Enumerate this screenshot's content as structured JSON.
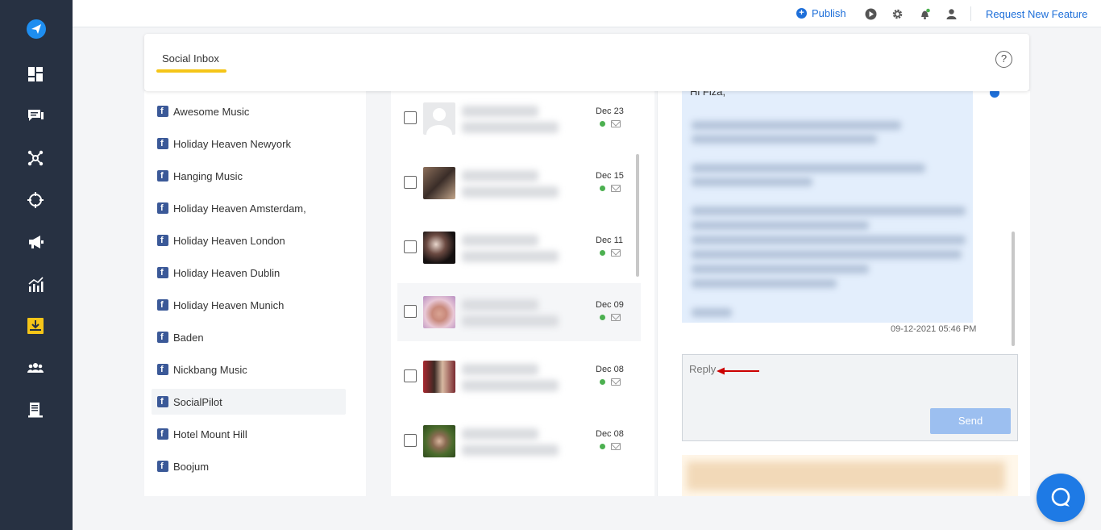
{
  "topbar": {
    "publish_label": "Publish",
    "request_label": "Request New Feature"
  },
  "header": {
    "tab_label": "Social Inbox",
    "help_label": "?"
  },
  "sidebar": {
    "icons": [
      "logo-send-icon",
      "dashboard-icon",
      "messages-icon",
      "network-icon",
      "target-icon",
      "megaphone-icon",
      "analytics-icon",
      "inbox-icon",
      "team-icon",
      "reports-icon"
    ],
    "active_icon": "inbox-icon",
    "accent_color": "#f5c518"
  },
  "accounts": [
    {
      "label": "Awesome Music"
    },
    {
      "label": "Holiday Heaven Newyork"
    },
    {
      "label": "Hanging Music"
    },
    {
      "label": "Holiday Heaven Amsterdam,"
    },
    {
      "label": "Holiday Heaven London"
    },
    {
      "label": "Holiday Heaven Dublin"
    },
    {
      "label": "Holiday Heaven Munich"
    },
    {
      "label": "Baden"
    },
    {
      "label": "Nickbang Music"
    },
    {
      "label": "SocialPilot",
      "active": true
    },
    {
      "label": "Hotel Mount Hill"
    },
    {
      "label": "Boojum"
    }
  ],
  "messages": [
    {
      "date": "Dec 23",
      "status": "online"
    },
    {
      "date": "Dec 15",
      "status": "online"
    },
    {
      "date": "Dec 11",
      "status": "online"
    },
    {
      "date": "Dec 09",
      "status": "online",
      "selected": true
    },
    {
      "date": "Dec 08",
      "status": "online"
    },
    {
      "date": "Dec 08",
      "status": "online"
    }
  ],
  "conversation": {
    "greeting": "Hi Fiza,",
    "timestamp": "09-12-2021 05:46 PM",
    "reply_placeholder": "Reply",
    "send_label": "Send"
  },
  "colors": {
    "brand_blue": "#1e6fd9",
    "rail_bg": "#273142",
    "online_green": "#4cb050",
    "annotation_arrow": "#cc0000"
  }
}
